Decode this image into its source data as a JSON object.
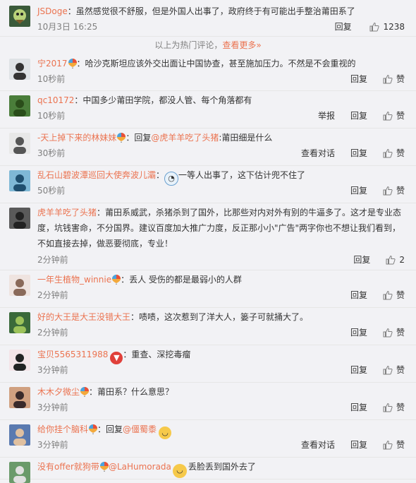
{
  "hot": {
    "user": "JSDoge",
    "text": "虽然感觉很不舒服，但是外国人出事了，政府终于有可能出手整治莆田系了",
    "time": "10月3日 16:25",
    "reply_label": "回复",
    "like_count": "1238"
  },
  "hot_footer": {
    "label": "以上为热门评论",
    "sep": "，",
    "more": "查看更多»"
  },
  "labels": {
    "reply": "回复",
    "report": "举报",
    "view_conv": "查看对话",
    "like": "赞"
  },
  "comments": [
    {
      "user": "宁2017",
      "text": "：哈沙克斯坦应该外交出面让中国协查，甚至施加压力。不然是不会重视的",
      "time": "10秒前",
      "badge": true
    },
    {
      "user": "qc10172",
      "text": "：中国多少莆田学院，都没人管、每个角落都有",
      "time": "10秒前",
      "badge": false
    },
    {
      "user": "-天上掉下来的林妹妹",
      "reply_prefix": "：回复",
      "reply_to": "@虎羊羊吃了头猪",
      "text": ":莆田细是什么",
      "time": "30秒前",
      "badge": true
    },
    {
      "user": "乱石山碧波潭巡回大使奔波儿灞",
      "text": "一等人出事了，这下估计兜不住了",
      "time": "50秒前",
      "badge": false
    },
    {
      "user": "虎羊羊吃了头猪",
      "text_lines": [
        "：莆田系威武，杀猪杀到了国外，比那些对内对外有别的牛逼多了。这才是专业态",
        "度，坑钱害命，不分国界。建议百度加大推广力度，反正那小小\"广告\"两字你也不想让我们看到，",
        "不如直接去掉，做恶要彻底，专业！"
      ],
      "time": "2分钟前",
      "like_count": "2",
      "badge": false
    },
    {
      "user": "一年生植物_winnie",
      "text": "：丢人 受伤的都是最弱小的人群",
      "time": "2分钟前",
      "badge": true
    },
    {
      "user": "好的大王是大王没错大王",
      "text": "：啧啧，这次惹到了洋大人，篓子可就捅大了。",
      "time": "2分钟前",
      "badge": false
    },
    {
      "user": "宝贝5565311988",
      "text": "：重查、深挖毒瘤",
      "time": "3分钟前",
      "badge": false
    },
    {
      "user": "木木夕微尘",
      "text": "：莆田系？什么意思？",
      "time": "3分钟前",
      "badge": true
    },
    {
      "user": "给你挂个脑科",
      "reply_prefix": "：回复",
      "reply_to": "@僵蜀黍",
      "text": "",
      "time": "3分钟前",
      "badge": true
    },
    {
      "user": "没有offer就狗带",
      "reply_to": "@LaHumorada",
      "text": "丢脸丢到国外去了",
      "time": "",
      "badge": true
    }
  ]
}
